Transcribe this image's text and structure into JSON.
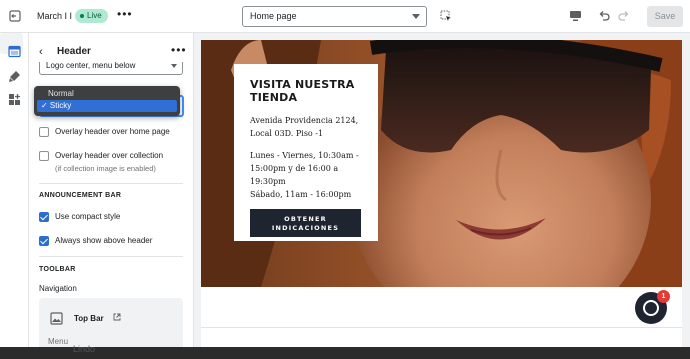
{
  "topbar": {
    "theme_name": "March I I",
    "live_label": "Live",
    "more_label": "•••",
    "page_select_value": "Home page",
    "save_label": "Save"
  },
  "panel": {
    "back_label": "‹",
    "title": "Header",
    "more_label": "•••",
    "logo_select_value": "Logo center, menu below",
    "overlay_home_label": "Overlay header over home page",
    "overlay_collection_label": "Overlay header over collection",
    "overlay_collection_helper": "(if collection image is enabled)",
    "announcement_section": "ANNOUNCEMENT BAR",
    "compact_style_label": "Use compact style",
    "always_show_label": "Always show above header",
    "toolbar_section": "TOOLBAR",
    "navigation_label": "Navigation",
    "nav_card_name": "Top Bar",
    "nav_card_menu": "Menu"
  },
  "dropdown": {
    "options": [
      "Normal",
      "✓ Sticky"
    ],
    "selected": "Sticky"
  },
  "preview": {
    "store_title": "VISITA NUESTRA TIENDA",
    "address_line1": "Avenida Providencia 2124,",
    "address_line2": "Local 03D. Piso -1",
    "hours_line1": "Lunes - Viernes, 10:30am -",
    "hours_line2": "15:00pm y de 16:00 a",
    "hours_line3": "19:30pm",
    "hours_line4": "Sábado, 11am - 16:00pm",
    "cta_line1": "OBTENER",
    "cta_line2": "INDICACIONES",
    "chat_badge": "1"
  },
  "bottom": {
    "ghost_text": "Lindo"
  },
  "colors": {
    "accent_blue": "#2c6ecb",
    "live_green": "#aee9d1",
    "cta_dark": "#1f2530",
    "badge_red": "#e53935"
  }
}
